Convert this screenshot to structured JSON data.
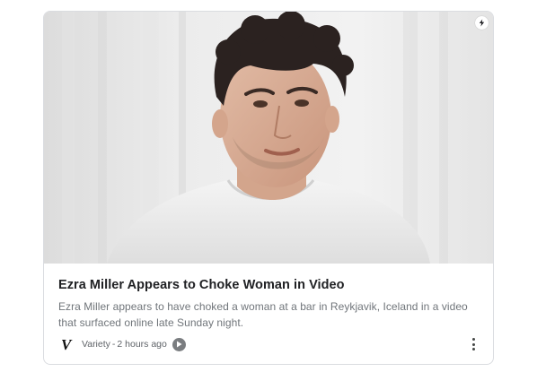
{
  "article": {
    "headline": "Ezra Miller Appears to Choke Woman in Video",
    "snippet": "Ezra Miller appears to have choked a woman at a bar in Reykjavik, Iceland in a video that surfaced online late Sunday night.",
    "source": "Variety",
    "separator": "-",
    "time": "2 hours ago",
    "source_logo": "V",
    "hero_image": "portrait of a young man with dark curly hair wearing a white t-shirt against a light background"
  },
  "icons": {
    "amp": "lightning-bolt-icon",
    "play": "play-icon",
    "more": "more-vertical-icon"
  },
  "colors": {
    "headline": "#202124",
    "snippet": "#70757a",
    "meta": "#5f6368",
    "border": "#dadce0"
  }
}
